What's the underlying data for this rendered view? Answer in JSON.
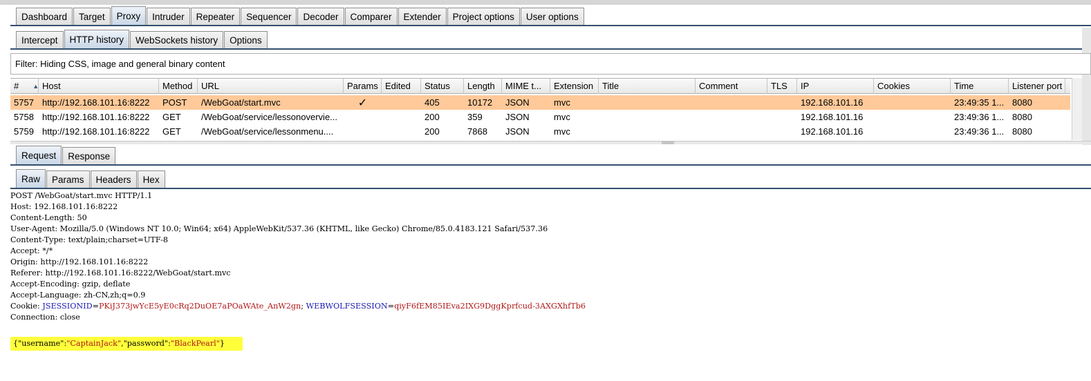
{
  "main_tabs": [
    "Dashboard",
    "Target",
    "Proxy",
    "Intruder",
    "Repeater",
    "Sequencer",
    "Decoder",
    "Comparer",
    "Extender",
    "Project options",
    "User options"
  ],
  "main_active": "Proxy",
  "proxy_tabs": [
    "Intercept",
    "HTTP history",
    "WebSockets history",
    "Options"
  ],
  "proxy_active": "HTTP history",
  "filter": "Filter: Hiding CSS, image and general binary content",
  "history": {
    "columns": [
      "#",
      "Host",
      "Method",
      "URL",
      "Params",
      "Edited",
      "Status",
      "Length",
      "MIME t...",
      "Extension",
      "Title",
      "Comment",
      "TLS",
      "IP",
      "Cookies",
      "Time",
      "Listener port"
    ],
    "sort_icon": "sort-ascending-icon",
    "selected_color": "#ffc999",
    "rows": [
      {
        "num": "5757",
        "host": "http://192.168.101.16:8222",
        "method": "POST",
        "url": "/WebGoat/start.mvc",
        "params": "✓",
        "edited": "",
        "status": "405",
        "length": "10172",
        "mime": "JSON",
        "extension": "mvc",
        "title": "",
        "comment": "",
        "tls": "",
        "ip": "192.168.101.16",
        "cookies": "",
        "time": "23:49:35 1...",
        "port": "8080"
      },
      {
        "num": "5758",
        "host": "http://192.168.101.16:8222",
        "method": "GET",
        "url": "/WebGoat/service/lessonovervie...",
        "params": "",
        "edited": "",
        "status": "200",
        "length": "359",
        "mime": "JSON",
        "extension": "mvc",
        "title": "",
        "comment": "",
        "tls": "",
        "ip": "192.168.101.16",
        "cookies": "",
        "time": "23:49:36 1...",
        "port": "8080"
      },
      {
        "num": "5759",
        "host": "http://192.168.101.16:8222",
        "method": "GET",
        "url": "/WebGoat/service/lessonmenu....",
        "params": "",
        "edited": "",
        "status": "200",
        "length": "7868",
        "mime": "JSON",
        "extension": "mvc",
        "title": "",
        "comment": "",
        "tls": "",
        "ip": "192.168.101.16",
        "cookies": "",
        "time": "23:49:36 1...",
        "port": "8080"
      }
    ]
  },
  "message_tabs": [
    "Request",
    "Response"
  ],
  "message_active": "Request",
  "view_tabs": [
    "Raw",
    "Params",
    "Headers",
    "Hex"
  ],
  "view_active": "Raw",
  "request": {
    "lines": [
      "POST /WebGoat/start.mvc HTTP/1.1",
      "Host: 192.168.101.16:8222",
      "Content-Length: 50",
      "User-Agent: Mozilla/5.0 (Windows NT 10.0; Win64; x64) AppleWebKit/537.36 (KHTML, like Gecko) Chrome/85.0.4183.121 Safari/537.36",
      "Content-Type: text/plain;charset=UTF-8",
      "Accept: */*",
      "Origin: http://192.168.101.16:8222",
      "Referer: http://192.168.101.16:8222/WebGoat/start.mvc",
      "Accept-Encoding: gzip, deflate",
      "Accept-Language: zh-CN,zh;q=0.9"
    ],
    "cookie_prefix": "Cookie: ",
    "cookie1_name": "JSESSIONID",
    "cookie1_value": "PKiJ373jwYcE5yE0cRq2DuOE7aPOaWAte_AnW2gn",
    "cookie_sep": "; ",
    "cookie2_name": "WEBWOLFSESSION",
    "cookie2_value": "qiyF6fEM85IEva2IXG9DggKprfcud-3AXGXhfTb6",
    "connection": "Connection: close",
    "body": {
      "open": "{",
      "k1": "\"username\"",
      "colon1": ":",
      "v1": "\"CaptainJack\"",
      "comma": ",",
      "k2": "\"password\"",
      "colon2": ":",
      "v2": "\"BlackPearl\"",
      "close": "}"
    },
    "highlight_color": "#ffff3c"
  }
}
